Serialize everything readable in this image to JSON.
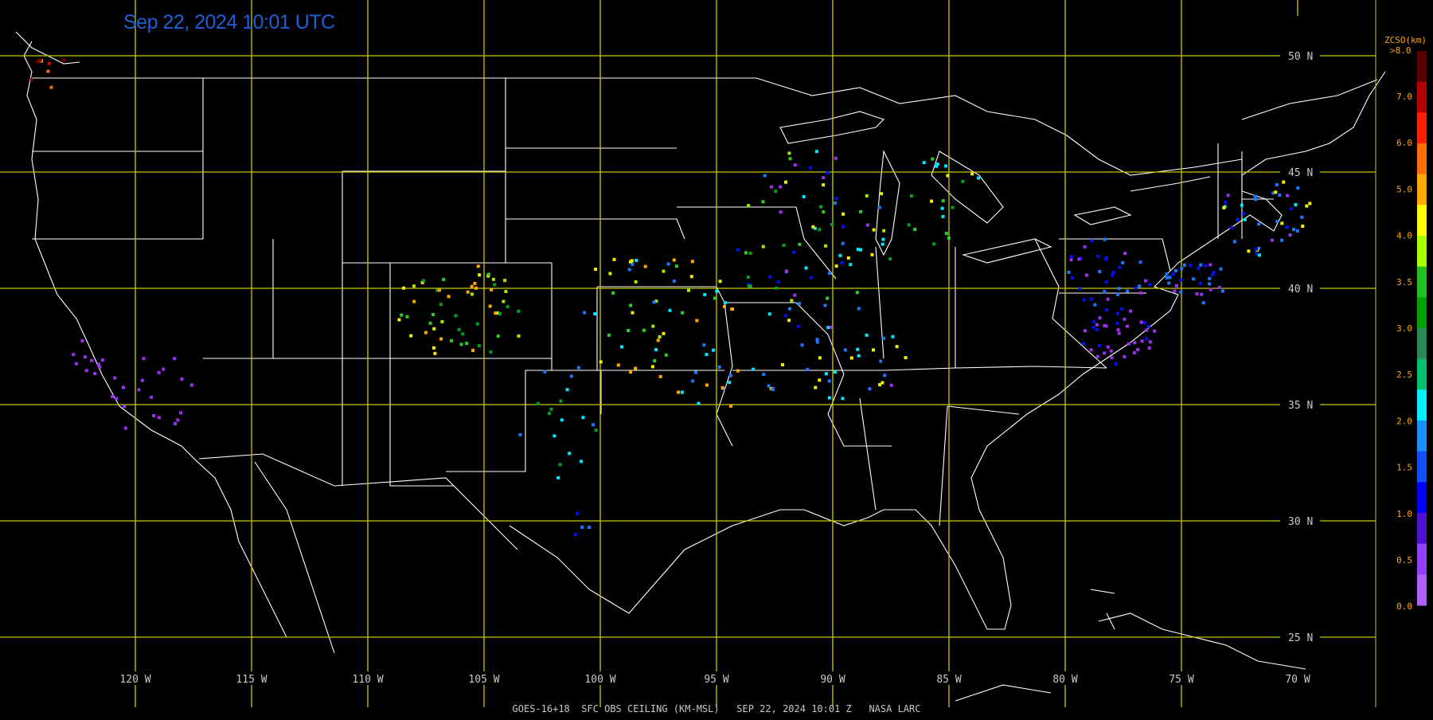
{
  "timestamp": "Sep 22, 2024 10:01 UTC",
  "footer": "GOES-16+18  SFC OBS CEILING (KM-MSL)   SEP 22, 2024 10:01 Z   NASA LARC",
  "grid": {
    "line_color": "#c8c800",
    "lat_labels": [
      "50 N",
      "45 N",
      "40 N",
      "35 N",
      "30 N",
      "25 N"
    ],
    "lon_labels": [
      "120 W",
      "115 W",
      "110 W",
      "105 W",
      "100 W",
      "95 W",
      "90 W",
      "85 W",
      "80 W",
      "75 W",
      "70 W"
    ]
  },
  "legend": {
    "title": "ZCSO(km)",
    "top_label": ">8.0",
    "tick_labels": [
      "7.0",
      "6.0",
      "5.0",
      "4.0",
      "3.5",
      "3.0",
      "2.5",
      "2.0",
      "1.5",
      "1.0",
      "0.5",
      "0.0"
    ],
    "colors": [
      "#5a0000",
      "#b00000",
      "#ff2000",
      "#ff7000",
      "#ffa800",
      "#ffff00",
      "#a8ff00",
      "#20c020",
      "#00a000",
      "#2a8a5a",
      "#00c070",
      "#00f0ff",
      "#1a90ff",
      "#1050ff",
      "#0000ff",
      "#5010d0",
      "#9040ff",
      "#b060ff"
    ]
  },
  "observations": {
    "description_units": "ceiling in km MSL",
    "color_scale": [
      "#9a30f0",
      "#0010ff",
      "#1a78ff",
      "#00e8ff",
      "#00a020",
      "#2ecc2e",
      "#a8e800",
      "#f0f000",
      "#ffa800",
      "#ff6a00",
      "#e00000",
      "#800000"
    ]
  }
}
